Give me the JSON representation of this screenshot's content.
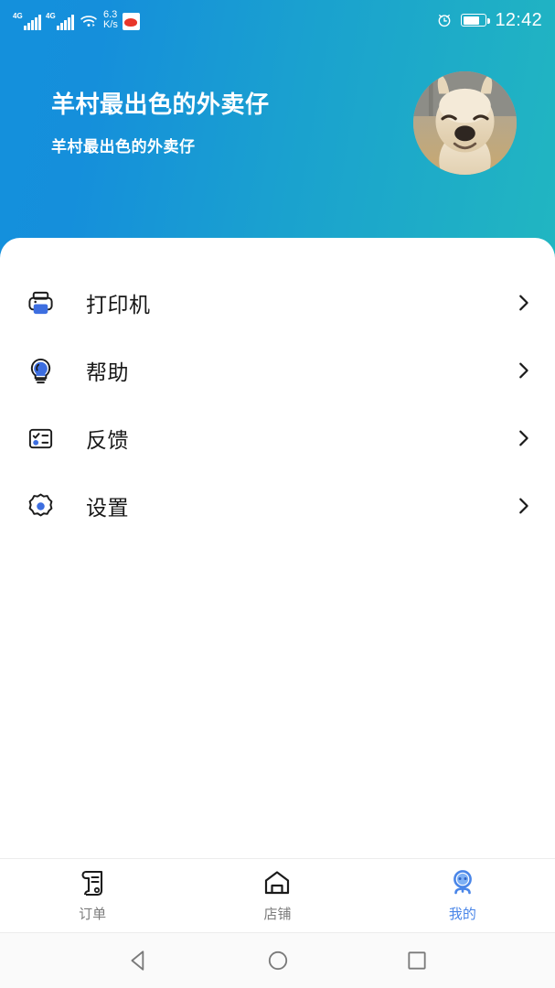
{
  "status_bar": {
    "network_type_1": "4G",
    "network_type_2": "4G",
    "speed_value": "6.3",
    "speed_unit": "K/s",
    "time": "12:42",
    "battery_percent": 66,
    "icons": [
      "signal-icon",
      "signal-icon",
      "wifi-icon",
      "app-notification-icon",
      "alarm-icon",
      "battery-icon"
    ]
  },
  "header": {
    "title": "羊村最出色的外卖仔",
    "subtitle": "羊村最出色的外卖仔",
    "avatar_alt": "alpaca-photo",
    "gradient_start": "#1490dc",
    "gradient_end": "#21b6c1"
  },
  "menu": {
    "items": [
      {
        "label": "打印机",
        "icon": "printer-icon",
        "name": "printer"
      },
      {
        "label": "帮助",
        "icon": "lightbulb-icon",
        "name": "help"
      },
      {
        "label": "反馈",
        "icon": "feedback-form-icon",
        "name": "feedback"
      },
      {
        "label": "设置",
        "icon": "gear-icon",
        "name": "settings"
      }
    ],
    "accent_color": "#3d6ee0"
  },
  "tabbar": {
    "tabs": [
      {
        "label": "订单",
        "icon": "receipt-icon",
        "name": "orders",
        "active": false
      },
      {
        "label": "店铺",
        "icon": "store-home-icon",
        "name": "store",
        "active": false
      },
      {
        "label": "我的",
        "icon": "profile-avatar-icon",
        "name": "mine",
        "active": true
      }
    ],
    "active_color": "#4a86e8",
    "inactive_color": "#7c7c7c"
  },
  "android_nav": {
    "buttons": [
      {
        "name": "back-button",
        "icon": "triangle-back-icon"
      },
      {
        "name": "home-button",
        "icon": "circle-home-icon"
      },
      {
        "name": "recents-button",
        "icon": "square-recents-icon"
      }
    ]
  }
}
